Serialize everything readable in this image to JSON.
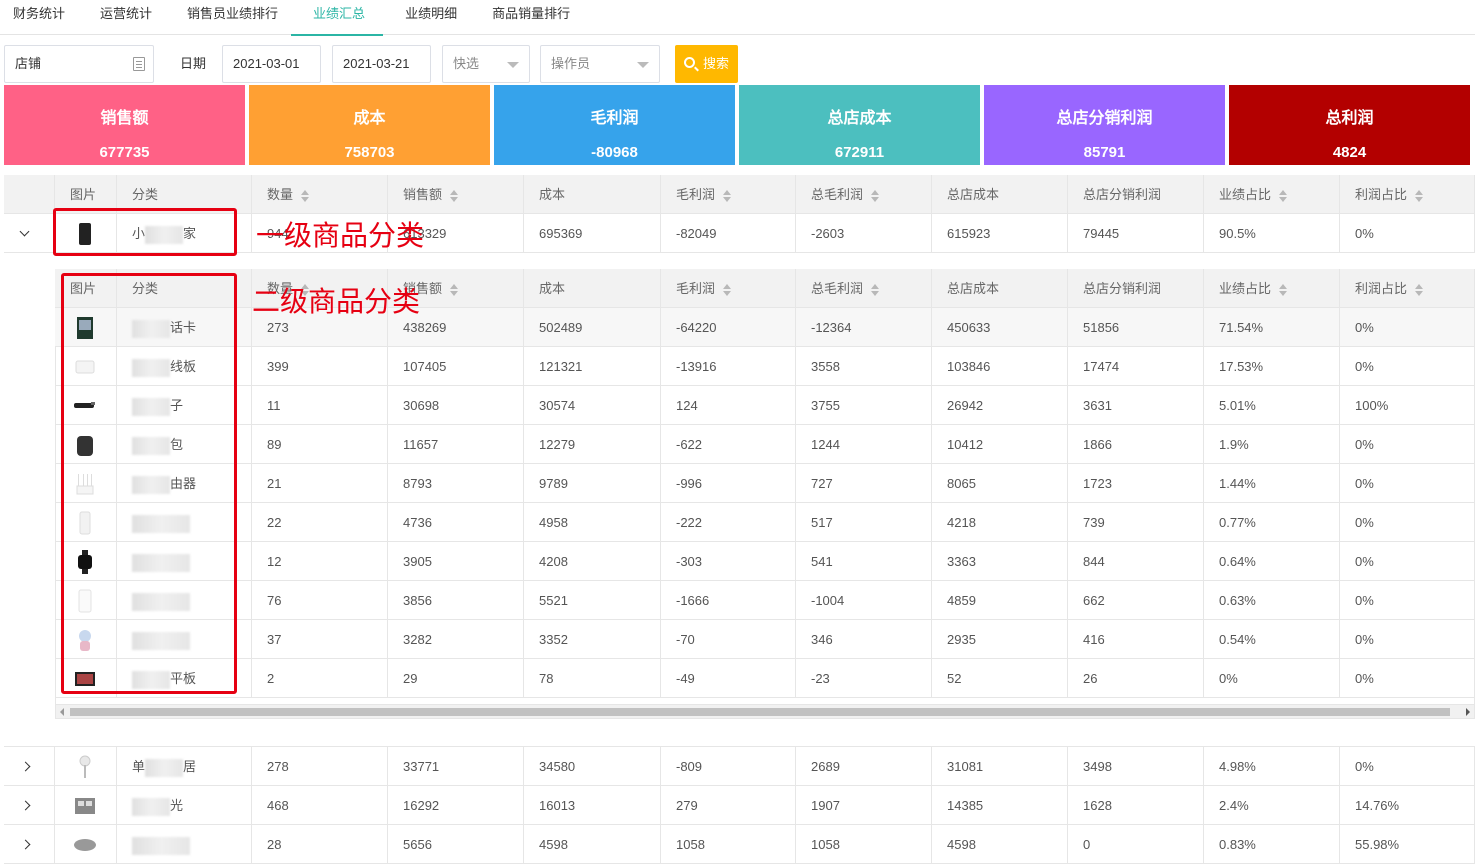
{
  "tabs": [
    "财务统计",
    "运营统计",
    "销售员业绩排行",
    "业绩汇总",
    "业绩明细",
    "商品销量排行"
  ],
  "active_tab": 3,
  "filter": {
    "store": "店铺",
    "date_label": "日期",
    "date_start": "2021-03-01",
    "date_end": "2021-03-21",
    "quick_select": "快选",
    "operator": "操作员",
    "search_label": "搜索"
  },
  "cards": [
    {
      "title": "销售额",
      "value": "677735",
      "color": "#ff6186"
    },
    {
      "title": "成本",
      "value": "758703",
      "color": "#ffa033"
    },
    {
      "title": "毛利润",
      "value": "-80968",
      "color": "#36a3eb"
    },
    {
      "title": "总店成本",
      "value": "672911",
      "color": "#4cbfbf"
    },
    {
      "title": "总店分销利润",
      "value": "85791",
      "color": "#9966ff"
    },
    {
      "title": "总利润",
      "value": "4824",
      "color": "#b30000"
    }
  ],
  "columns": [
    "图片",
    "分类",
    "数量",
    "销售额",
    "成本",
    "毛利润",
    "总毛利润",
    "总店成本",
    "总店分销利润",
    "业绩占比",
    "利润占比"
  ],
  "sortable": [
    false,
    false,
    true,
    true,
    false,
    true,
    true,
    false,
    false,
    true,
    true
  ],
  "primary_rows": [
    {
      "name_visible": "小",
      "name_tail": "家",
      "thumb": "phone",
      "values": [
        "944",
        "613329",
        "695369",
        "-82049",
        "-2603",
        "615923",
        "79445",
        "90.5%",
        "0%"
      ]
    },
    {
      "name_visible": "单",
      "name_tail": "居",
      "thumb": "lamp",
      "values": [
        "278",
        "33771",
        "34580",
        "-809",
        "2689",
        "31081",
        "3498",
        "4.98%",
        "0%"
      ]
    },
    {
      "name_visible": "",
      "name_tail": "光",
      "thumb": "box",
      "values": [
        "468",
        "16292",
        "16013",
        "279",
        "1907",
        "14385",
        "1628",
        "2.4%",
        "14.76%"
      ]
    },
    {
      "name_visible": "",
      "name_tail": "",
      "thumb": "gray",
      "values": [
        "28",
        "5656",
        "4598",
        "1058",
        "1058",
        "4598",
        "0",
        "0.83%",
        "55.98%"
      ]
    }
  ],
  "secondary_rows": [
    {
      "name_visible": "",
      "name_tail": "话卡",
      "thumb": "card",
      "values": [
        "273",
        "438269",
        "502489",
        "-64220",
        "-12364",
        "450633",
        "51856",
        "71.54%",
        "0%"
      ]
    },
    {
      "name_visible": "",
      "name_tail": "线板",
      "thumb": "white",
      "values": [
        "399",
        "107405",
        "121321",
        "-13916",
        "3558",
        "103846",
        "17474",
        "17.53%",
        "0%"
      ]
    },
    {
      "name_visible": "",
      "name_tail": "子",
      "thumb": "stick",
      "values": [
        "11",
        "30698",
        "30574",
        "124",
        "3755",
        "26942",
        "3631",
        "5.01%",
        "100%"
      ]
    },
    {
      "name_visible": "",
      "name_tail": "包",
      "thumb": "bag",
      "values": [
        "89",
        "11657",
        "12279",
        "-622",
        "1244",
        "10412",
        "1866",
        "1.9%",
        "0%"
      ]
    },
    {
      "name_visible": "",
      "name_tail": "由器",
      "thumb": "router",
      "values": [
        "21",
        "8793",
        "9789",
        "-996",
        "727",
        "8065",
        "1723",
        "1.44%",
        "0%"
      ]
    },
    {
      "name_visible": "",
      "name_tail": "",
      "thumb": "tall",
      "values": [
        "22",
        "4736",
        "4958",
        "-222",
        "517",
        "4218",
        "739",
        "0.77%",
        "0%"
      ]
    },
    {
      "name_visible": "",
      "name_tail": "",
      "thumb": "watch",
      "values": [
        "12",
        "3905",
        "4208",
        "-303",
        "541",
        "3363",
        "844",
        "0.64%",
        "0%"
      ]
    },
    {
      "name_visible": "",
      "name_tail": "",
      "thumb": "phonew",
      "values": [
        "76",
        "3856",
        "5521",
        "-1666",
        "-1004",
        "4859",
        "662",
        "0.63%",
        "0%"
      ]
    },
    {
      "name_visible": "",
      "name_tail": "",
      "thumb": "toy",
      "values": [
        "37",
        "3282",
        "3352",
        "-70",
        "346",
        "2935",
        "416",
        "0.54%",
        "0%"
      ]
    },
    {
      "name_visible": "",
      "name_tail": "平板",
      "thumb": "tablet",
      "values": [
        "2",
        "29",
        "78",
        "-49",
        "-23",
        "52",
        "26",
        "0%",
        "0%"
      ]
    }
  ],
  "annotations": {
    "level1": "一级商品分类",
    "level2": "二级商品分类"
  }
}
